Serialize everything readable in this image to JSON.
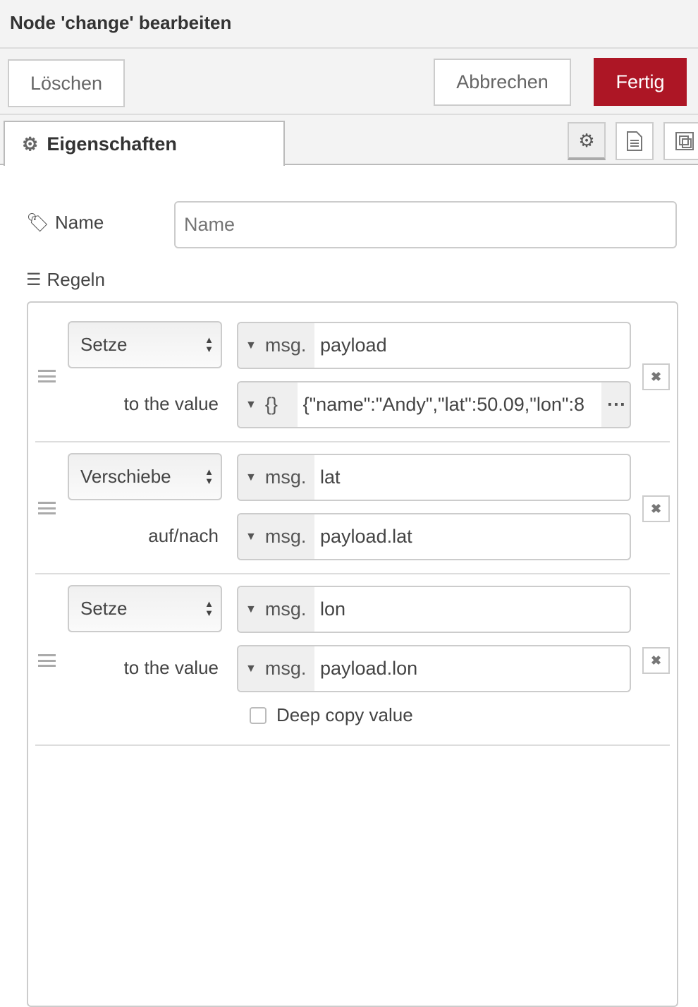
{
  "header": {
    "title": "Node 'change' bearbeiten"
  },
  "toolbar": {
    "delete_label": "Löschen",
    "cancel_label": "Abbrechen",
    "done_label": "Fertig",
    "accent": "#ad1625"
  },
  "tabs": {
    "properties_label": "Eigenschaften",
    "icons": [
      "gear-icon",
      "file-text-icon",
      "layout-icon"
    ]
  },
  "form": {
    "name_label": "Name",
    "name_placeholder": "Name",
    "name_value": "",
    "rules_label": "Regeln"
  },
  "rules": [
    {
      "action": "Setze",
      "prop_prefix": "msg.",
      "prop": "payload",
      "value_label": "to the value",
      "value_prefix": "{}",
      "value": "{\"name\":\"Andy\",\"lat\":50.09,\"lon\":8"
    },
    {
      "action": "Verschiebe",
      "prop_prefix": "msg.",
      "prop": "lat",
      "value_label": "auf/nach",
      "value_prefix": "msg.",
      "value": "payload.lat"
    },
    {
      "action": "Setze",
      "prop_prefix": "msg.",
      "prop": "lon",
      "value_label": "to the value",
      "value_prefix": "msg.",
      "value": "payload.lon",
      "deep_copy_label": "Deep copy value",
      "deep_copy": false
    }
  ]
}
